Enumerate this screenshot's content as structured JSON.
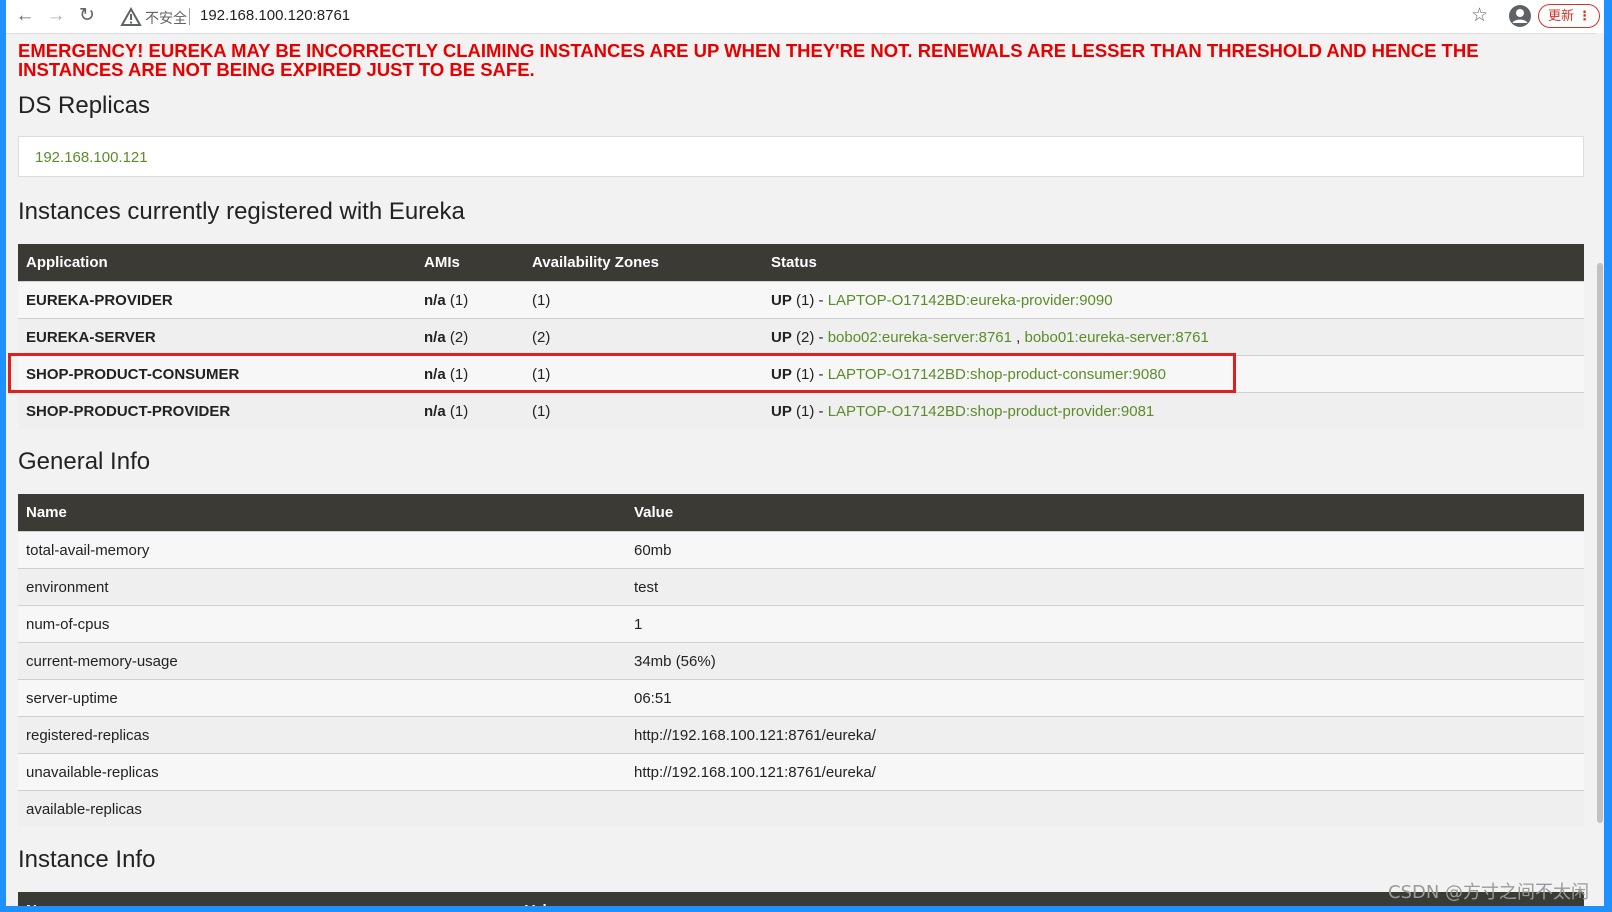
{
  "browser": {
    "insecure_label": "不安全",
    "url": "192.168.100.120:8761",
    "update_label": "更新"
  },
  "page": {
    "emergency": "EMERGENCY! EUREKA MAY BE INCORRECTLY CLAIMING INSTANCES ARE UP WHEN THEY'RE NOT. RENEWALS ARE LESSER THAN THRESHOLD AND HENCE THE INSTANCES ARE NOT BEING EXPIRED JUST TO BE SAFE.",
    "ds_replicas_title": "DS Replicas",
    "ds_replica": "192.168.100.121",
    "instances_title": "Instances currently registered with Eureka",
    "general_title": "General Info",
    "instance_info_title": "Instance Info"
  },
  "instances": {
    "headers": [
      "Application",
      "AMIs",
      "Availability Zones",
      "Status"
    ],
    "rows": [
      {
        "app": "EUREKA-PROVIDER",
        "ami_na": "n/a",
        "ami_count": "(1)",
        "zones": "(1)",
        "status_up": "UP",
        "status_count": "(1) - ",
        "links": [
          "LAPTOP-O17142BD:eureka-provider:9090"
        ],
        "sep": ""
      },
      {
        "app": "EUREKA-SERVER",
        "ami_na": "n/a",
        "ami_count": "(2)",
        "zones": "(2)",
        "status_up": "UP",
        "status_count": "(2) - ",
        "links": [
          "bobo02:eureka-server:8761",
          "bobo01:eureka-server:8761"
        ],
        "sep": " , "
      },
      {
        "app": "SHOP-PRODUCT-CONSUMER",
        "ami_na": "n/a",
        "ami_count": "(1)",
        "zones": "(1)",
        "status_up": "UP",
        "status_count": "(1) - ",
        "links": [
          "LAPTOP-O17142BD:shop-product-consumer:9080"
        ],
        "sep": ""
      },
      {
        "app": "SHOP-PRODUCT-PROVIDER",
        "ami_na": "n/a",
        "ami_count": "(1)",
        "zones": "(1)",
        "status_up": "UP",
        "status_count": "(1) - ",
        "links": [
          "LAPTOP-O17142BD:shop-product-provider:9081"
        ],
        "sep": ""
      }
    ]
  },
  "general": {
    "headers": [
      "Name",
      "Value"
    ],
    "rows": [
      {
        "name": "total-avail-memory",
        "value": "60mb"
      },
      {
        "name": "environment",
        "value": "test"
      },
      {
        "name": "num-of-cpus",
        "value": "1"
      },
      {
        "name": "current-memory-usage",
        "value": "34mb (56%)"
      },
      {
        "name": "server-uptime",
        "value": "06:51"
      },
      {
        "name": "registered-replicas",
        "value": "http://192.168.100.121:8761/eureka/"
      },
      {
        "name": "unavailable-replicas",
        "value": "http://192.168.100.121:8761/eureka/"
      },
      {
        "name": "available-replicas",
        "value": ""
      }
    ]
  },
  "instance_info": {
    "headers": [
      "Name",
      "Value"
    ]
  },
  "watermark": "CSDN @方寸之间不太闲",
  "colors": {
    "emergency": "#e60000",
    "link": "#5b8c2a",
    "table_header": "#3c3a35",
    "highlight": "#e02020"
  }
}
